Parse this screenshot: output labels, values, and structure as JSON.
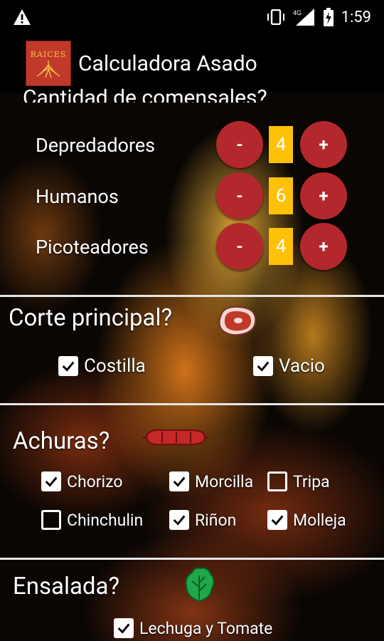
{
  "status_bar": {
    "time": "1:59",
    "network": "4G"
  },
  "app_bar": {
    "title": "Calculadora Asado",
    "logo_text": "RAICES"
  },
  "diners": {
    "header_partial": "Cantidad de comensales?",
    "rows": [
      {
        "label": "Depredadores",
        "count": "4"
      },
      {
        "label": "Humanos",
        "count": "6"
      },
      {
        "label": "Picoteadores",
        "count": "4"
      }
    ],
    "minus_label": "-",
    "plus_label": "+"
  },
  "main_cut": {
    "title": "Corte principal?",
    "options": [
      {
        "label": "Costilla",
        "checked": true
      },
      {
        "label": "Vacio",
        "checked": true
      }
    ]
  },
  "offal": {
    "title": "Achuras?",
    "options": [
      {
        "label": "Chorizo",
        "checked": true
      },
      {
        "label": "Morcilla",
        "checked": true
      },
      {
        "label": "Tripa",
        "checked": false
      },
      {
        "label": "Chinchulin",
        "checked": false
      },
      {
        "label": "Riñon",
        "checked": true
      },
      {
        "label": "Molleja",
        "checked": true
      }
    ]
  },
  "salad": {
    "title": "Ensalada?",
    "options": [
      {
        "label": "Lechuga y Tomate",
        "checked": true
      }
    ]
  },
  "colors": {
    "button_red": "#b3282d",
    "count_yellow": "#ffc107"
  }
}
